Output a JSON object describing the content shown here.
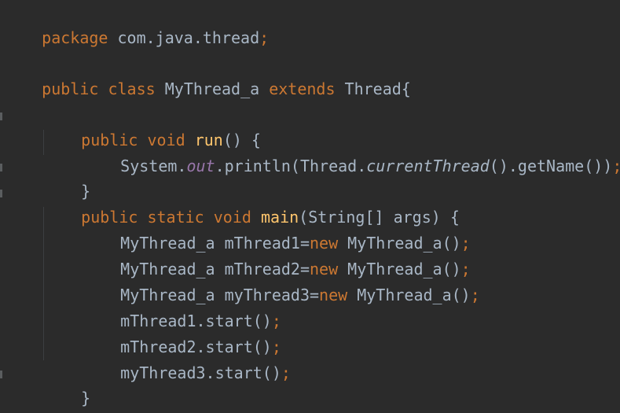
{
  "editor": {
    "lines": {
      "l1": {
        "kw": "package",
        "rest": " com.java.thread",
        "semi": ";"
      },
      "l3": {
        "kw1": "public",
        "kw2": "class",
        "name": "MyThread_a",
        "kw3": "extends",
        "parent": "Thread{"
      },
      "l5": {
        "kw1": "public",
        "kw2": "void",
        "fn": "run",
        "rest": "() {"
      },
      "l6": {
        "a": "System.",
        "field": "out",
        "b": ".println(Thread.",
        "c": "currentThread",
        "d": "().getName())",
        "semi": ";"
      },
      "l7": {
        "text": "}"
      },
      "l8": {
        "kw1": "public",
        "kw2": "static",
        "kw3": "void",
        "fn": "main",
        "rest": "(String[] args) {"
      },
      "l9": {
        "a": "MyThread_a mThread1=",
        "kw": "new",
        "b": " MyThread_a()",
        "semi": ";"
      },
      "l10": {
        "a": "MyThread_a mThread2=",
        "kw": "new",
        "b": " MyThread_a()",
        "semi": ";"
      },
      "l11": {
        "a": "MyThread_a myThread3=",
        "kw": "new",
        "b": " MyThread_a()",
        "semi": ";"
      },
      "l12": {
        "a": "mThread1.start()",
        "semi": ";"
      },
      "l13": {
        "a": "mThread2.start()",
        "semi": ";"
      },
      "l14": {
        "a": "myThread3.start()",
        "semi": ";"
      },
      "l15": {
        "text": "}"
      },
      "l16": {
        "text": "}"
      }
    },
    "colors": {
      "background": "#2b2b2b",
      "keyword": "#cc7832",
      "identifier": "#a9b7c6",
      "function": "#ffc66d",
      "field": "#9876aa"
    }
  }
}
